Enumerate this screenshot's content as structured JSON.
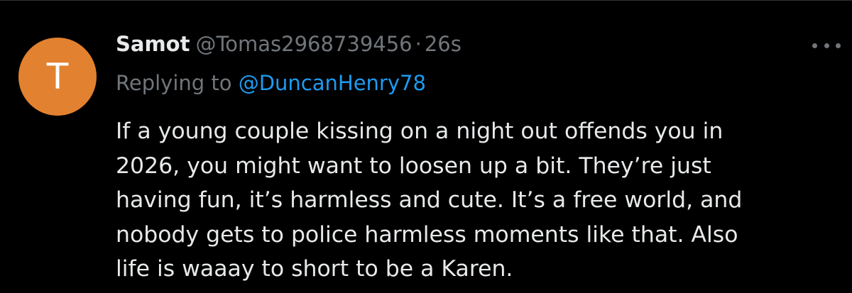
{
  "author": {
    "avatar_letter": "T",
    "avatar_color": "#e2812f",
    "display_name": "Samot",
    "handle": "@Tomas2968739456",
    "separator": "·",
    "time": "26s"
  },
  "reply": {
    "prefix": "Replying to",
    "mention": "@DuncanHenry78"
  },
  "tweet": {
    "lines": [
      "If a young couple kissing on a night out offends you in",
      "2026, you might want to loosen up a bit. They’re just",
      "having fun, it’s harmless and cute. It’s a free world, and",
      "nobody gets to police harmless moments like that. Also",
      "life is waaay to short to be a Karen."
    ]
  },
  "icons": {
    "more": "more-horizontal-icon"
  },
  "colors": {
    "background": "#000000",
    "text": "#e7e9ea",
    "secondary": "#71767b",
    "link": "#1d9bf0"
  }
}
